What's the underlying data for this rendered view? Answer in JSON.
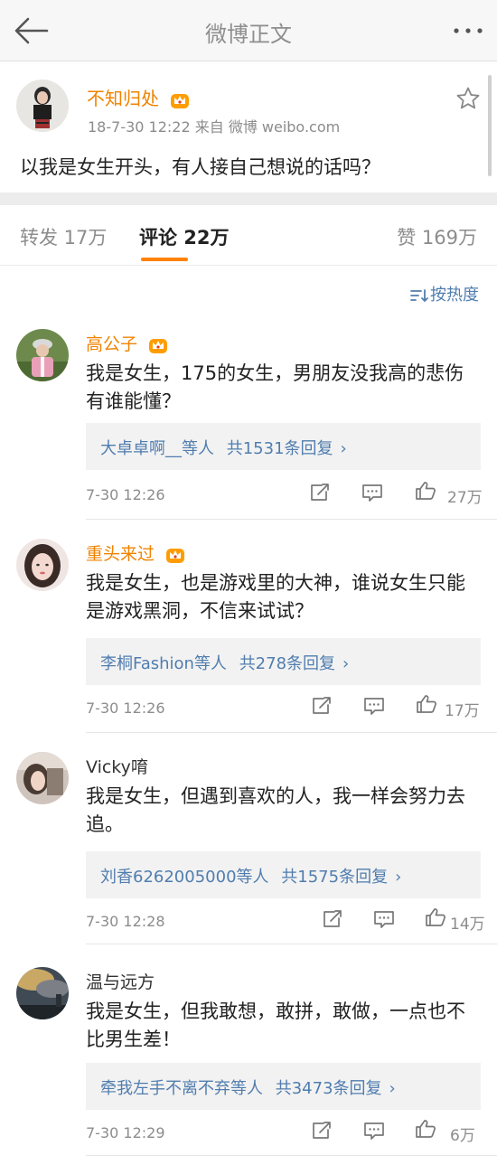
{
  "header": {
    "title": "微博正文",
    "back_icon": "arrow-left-icon",
    "more_icon": "more-dots-icon"
  },
  "post": {
    "username": "不知归处",
    "badge_icon": "vip-crown-icon",
    "meta": "18-7-30  12:22  来自 微博 weibo.com",
    "text": "以我是女生开头，有人接自己想说的话吗？",
    "star_icon": "star-outline-icon"
  },
  "tabs": {
    "repost": "转发 17万",
    "comments": "评论 22万",
    "likes": "赞 169万"
  },
  "sort": {
    "label": "按热度",
    "icon": "sort-icon"
  },
  "comments": [
    {
      "username": "高公子",
      "has_badge": true,
      "text": "我是女生，175的女生，男朋友没我高的悲伤有谁能懂？",
      "reply_users": "大卓卓啊__等人",
      "reply_count": "共1531条回复",
      "time": "7-30 12:26",
      "likes": "27万"
    },
    {
      "username": "重头来过",
      "has_badge": true,
      "text": "我是女生，也是游戏里的大神，谁说女生只能是游戏黑洞，不信来试试？",
      "reply_users": "李桐Fashion等人",
      "reply_count": "共278条回复",
      "time": "7-30 12:26",
      "likes": "17万"
    },
    {
      "username": "Vicky唷",
      "has_badge": false,
      "text": "我是女生，但遇到喜欢的人，我一样会努力去追。",
      "reply_users": "刘香6262005000等人",
      "reply_count": "共1575条回复",
      "time": "7-30 12:28",
      "likes": "14万"
    },
    {
      "username": "温与远方",
      "has_badge": false,
      "text": "我是女生，但我敢想，敢拼，敢做，一点也不比男生差！",
      "reply_users": "牵我左手不离不弃等人",
      "reply_count": "共3473条回复",
      "time": "7-30 12:29",
      "likes": "6万"
    }
  ],
  "colors": {
    "accent_orange": "#ff8200",
    "username_orange": "#f08300",
    "link_blue": "#507daf",
    "muted_gray": "#8c8c8c"
  }
}
